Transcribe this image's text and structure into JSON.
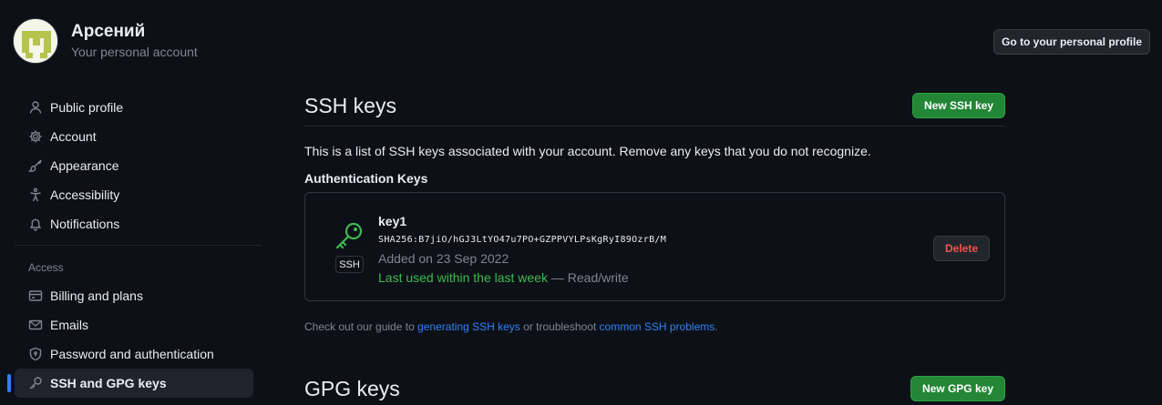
{
  "header": {
    "user_name": "Арсений",
    "subtitle": "Your personal account",
    "profile_button": "Go to your personal profile"
  },
  "sidebar": {
    "items": [
      {
        "label": "Public profile",
        "icon": "person-icon"
      },
      {
        "label": "Account",
        "icon": "gear-icon"
      },
      {
        "label": "Appearance",
        "icon": "paintbrush-icon"
      },
      {
        "label": "Accessibility",
        "icon": "accessibility-icon"
      },
      {
        "label": "Notifications",
        "icon": "bell-icon"
      }
    ],
    "section_label": "Access",
    "access_items": [
      {
        "label": "Billing and plans",
        "icon": "credit-card-icon"
      },
      {
        "label": "Emails",
        "icon": "mail-icon"
      },
      {
        "label": "Password and authentication",
        "icon": "shield-lock-icon"
      },
      {
        "label": "SSH and GPG keys",
        "icon": "key-icon",
        "active": true
      }
    ]
  },
  "ssh": {
    "title": "SSH keys",
    "new_button": "New SSH key",
    "description": "This is a list of SSH keys associated with your account. Remove any keys that you do not recognize.",
    "auth_heading": "Authentication Keys",
    "key": {
      "badge": "SSH",
      "name": "key1",
      "fingerprint": "SHA256:B7jiO/hGJ3LtYO47u7PO+GZPPVYLPsKgRyI89OzrB/M",
      "added": "Added on 23 Sep 2022",
      "last_used": "Last used within the last week",
      "access": " — Read/write",
      "delete_button": "Delete"
    },
    "guide": {
      "prefix": "Check out our guide to ",
      "link1": "generating SSH keys",
      "middle": " or troubleshoot ",
      "link2": "common SSH problems",
      "suffix": "."
    }
  },
  "gpg": {
    "title": "GPG keys",
    "new_button": "New GPG key"
  },
  "colors": {
    "background": "#0d1117",
    "accent_blue": "#2f81f7",
    "green_button": "#238636",
    "success_green": "#3fb950",
    "danger_red": "#f85149"
  }
}
